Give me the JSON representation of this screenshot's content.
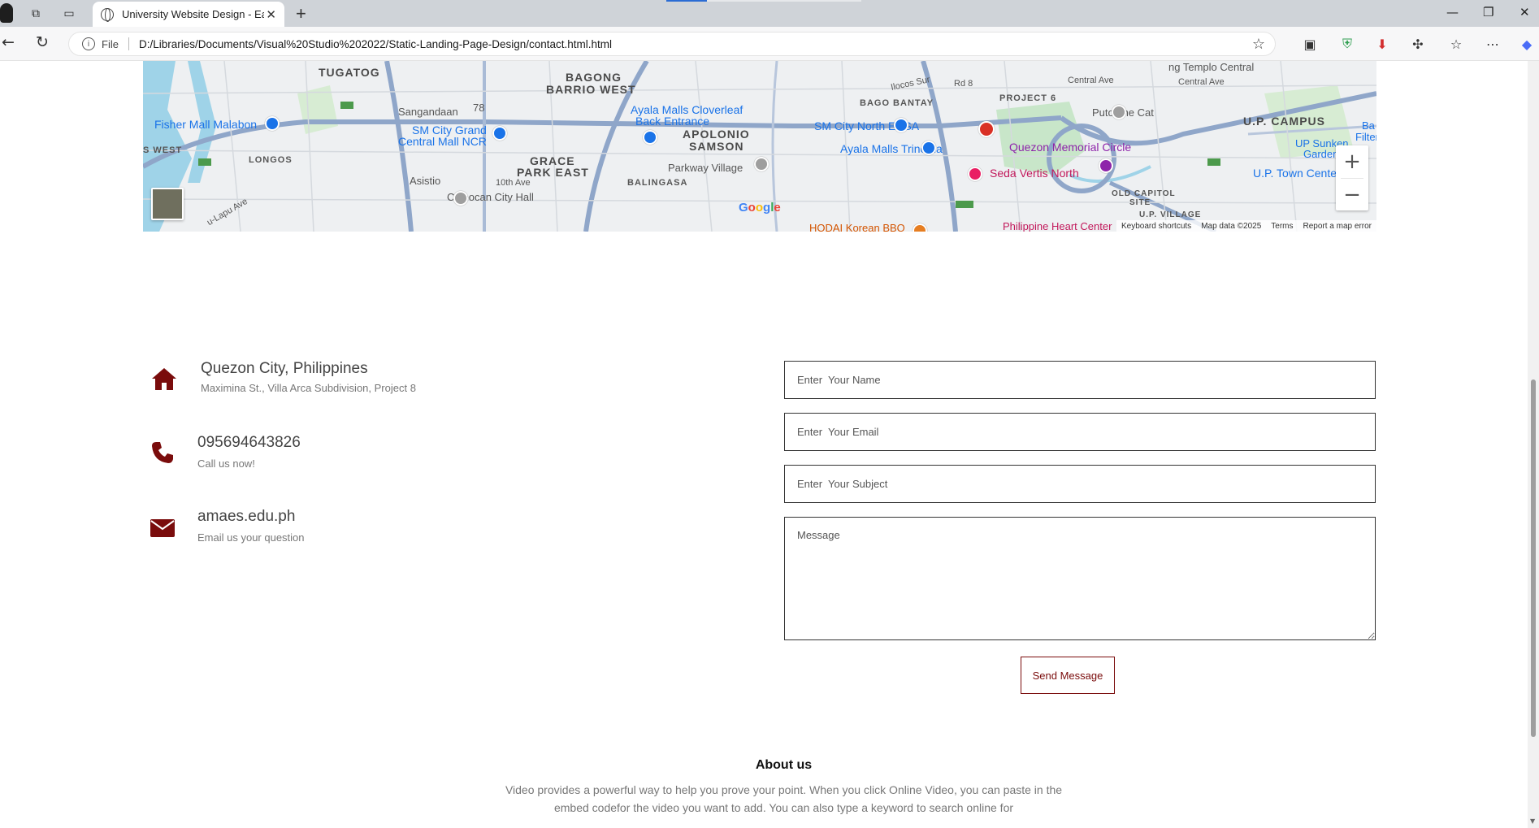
{
  "browser": {
    "tab_title": "University Website Design - Easy",
    "address_protocol": "File",
    "url": "D:/Libraries/Documents/Visual%20Studio%202022/Static-Landing-Page-Design/contact.html.html"
  },
  "map": {
    "labels": {
      "tugatog": "TUGATOG",
      "bagong_barrio_1": "BAGONG",
      "bagong_barrio_2": "BARRIO WEST",
      "sangandaan": "Sangandaan",
      "num78": "78",
      "fisher_mall": "Fisher Mall Malabon",
      "s_west": "S WEST",
      "longos": "LONGOS",
      "asistio": "Asistio",
      "sm_grand_1": "SM City Grand",
      "sm_grand_2": "Central Mall NCR",
      "grace_1": "GRACE",
      "grace_2": "PARK EAST",
      "tenth_ave": "10th Ave",
      "caloocan_hall": "Caloocan City Hall",
      "ayala_cloverleaf_1": "Ayala Malls Cloverleaf",
      "ayala_cloverleaf_2": "Back Entrance",
      "apolonio_1": "APOLONIO",
      "apolonio_2": "SAMSON",
      "parkway": "Parkway Village",
      "balingasa": "BALINGASA",
      "sm_north": "SM City North EDSA",
      "bago_bantay": "BAGO BANTAY",
      "project6": "PROJECT 6",
      "ayala_trinoma": "Ayala Malls Trinoma",
      "seda": "Seda Vertis North",
      "qc_circle": "Quezon Memorial Circle",
      "putot": "Putot the Cat",
      "up_campus": "U.P. CAMPUS",
      "up_sunken_1": "UP Sunken",
      "up_sunken_2": "Garden",
      "up_town": "U.P. Town Center",
      "old_capitol_1": "OLD CAPITOL",
      "old_capitol_2": "SITE",
      "up_village": "U.P. VILLAGE",
      "templo": "ng Templo Central",
      "central_ave_1": "Central Ave",
      "central_ave_2": "Central Ave",
      "hodai": "HODAI Korean BBQ",
      "phil_heart": "Philippine Heart Center",
      "ilocos_sur": "Ilocos Sur",
      "rd8": "Rd 8",
      "lapu": "u-Lapu Ave",
      "ba_filter_1": "Ba",
      "ba_filter_2": "Filter",
      "google": "Google"
    },
    "footer": {
      "shortcuts": "Keyboard shortcuts",
      "data": "Map data ©2025",
      "terms": "Terms",
      "report": "Report a map error"
    }
  },
  "contact": {
    "address_title": "Quezon City, Philippines",
    "address_sub": "Maximina St., Villa Arca Subdivision, Project 8",
    "phone_title": "095694643826",
    "phone_sub": "Call us now!",
    "email_title": "amaes.edu.ph",
    "email_sub": "Email us your question"
  },
  "form": {
    "name_placeholder": "Enter  Your Name",
    "email_placeholder": "Enter  Your Email",
    "subject_placeholder": "Enter  Your Subject",
    "message_placeholder": "Message",
    "send_label": "Send Message"
  },
  "about": {
    "title": "About us",
    "text_line1": "Video provides a powerful way to help you prove your point. When you click Online Video, you can paste in the",
    "text_line2": "embed codefor the video you want to add. You can also type a keyword to search online for"
  },
  "colors": {
    "accent": "#7a0c0c",
    "map_road": "#8fa6c9",
    "map_water": "#9fd3e8",
    "map_green": "#c8e6c9"
  }
}
